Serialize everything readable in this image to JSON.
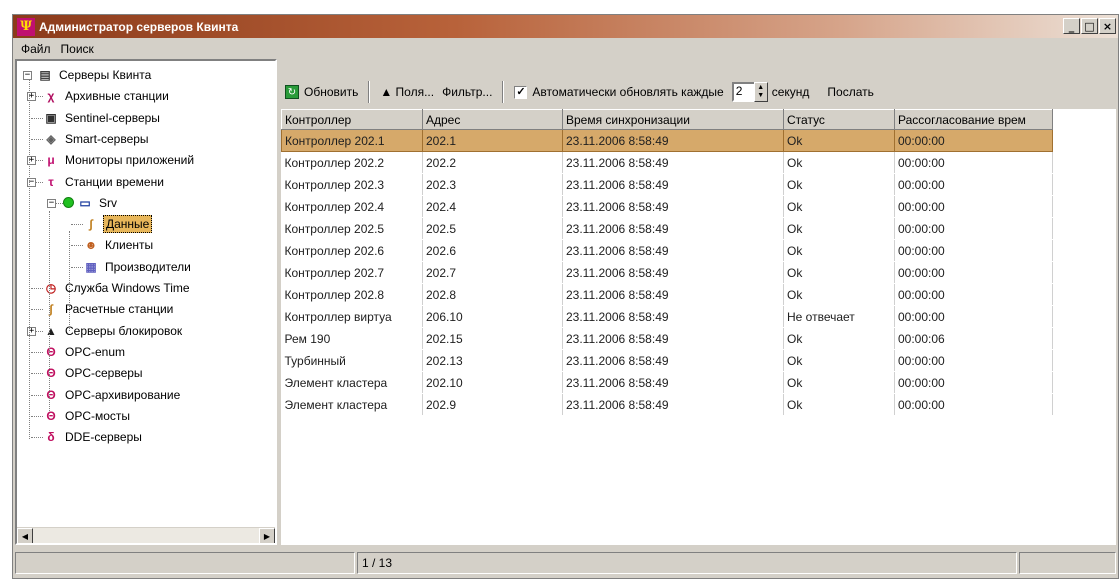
{
  "window": {
    "title": "Администратор серверов Квинта",
    "controls": [
      "_",
      "□",
      "×"
    ]
  },
  "menu": [
    "Файл",
    "Поиск"
  ],
  "tree": [
    {
      "label": "Серверы Квинта",
      "icon": "servers-icon",
      "expander": "−"
    },
    {
      "label": "Архивные станции",
      "icon": "archive-stations-icon",
      "expander": "+"
    },
    {
      "label": "Sentinel-серверы",
      "icon": "sentinel-icon",
      "expander": ""
    },
    {
      "label": "Smart-серверы",
      "icon": "smart-server-icon",
      "expander": ""
    },
    {
      "label": "Мониторы приложений",
      "icon": "mu-monitor-icon",
      "expander": "+"
    },
    {
      "label": "Станции времени",
      "icon": "tau-time-icon",
      "expander": "−"
    },
    {
      "label": "Srv",
      "icon": "computer-icon",
      "expander": "−"
    },
    {
      "label": "Данные",
      "icon": "data-icon",
      "expander": "",
      "selected": true
    },
    {
      "label": "Клиенты",
      "icon": "clients-icon",
      "expander": ""
    },
    {
      "label": "Производители",
      "icon": "producers-icon",
      "expander": ""
    },
    {
      "label": "Служба Windows Time",
      "icon": "clock-icon",
      "expander": ""
    },
    {
      "label": "Расчетные станции",
      "icon": "calc-station-icon",
      "expander": ""
    },
    {
      "label": "Серверы блокировок",
      "icon": "lock-icon",
      "expander": "+"
    },
    {
      "label": "OPC-enum",
      "icon": "theta-icon",
      "expander": ""
    },
    {
      "label": "OPC-серверы",
      "icon": "theta-icon",
      "expander": ""
    },
    {
      "label": "OPC-архивирование",
      "icon": "theta-icon",
      "expander": ""
    },
    {
      "label": "OPC-мосты",
      "icon": "theta-bridge-icon",
      "expander": ""
    },
    {
      "label": "DDE-серверы",
      "icon": "delta-icon",
      "expander": ""
    }
  ],
  "toolbar": {
    "refresh": "Обновить",
    "fields": "▲ Поля...",
    "filter": "Фильтр...",
    "auto_refresh": "Автоматически обновлять каждые",
    "auto_refresh_checked": true,
    "interval_value": "2",
    "seconds": "секунд",
    "send": "Послать"
  },
  "table": {
    "columns": [
      "Контроллер",
      "Адрес",
      "Время синхронизации",
      "Статус",
      "Рассогласование врем"
    ],
    "rows": [
      [
        "Контроллер 202.1",
        "202.1",
        "23.11.2006 8:58:49",
        "Ok",
        "00:00:00"
      ],
      [
        "Контроллер 202.2",
        "202.2",
        "23.11.2006 8:58:49",
        "Ok",
        "00:00:00"
      ],
      [
        "Контроллер 202.3",
        "202.3",
        "23.11.2006 8:58:49",
        "Ok",
        "00:00:00"
      ],
      [
        "Контроллер 202.4",
        "202.4",
        "23.11.2006 8:58:49",
        "Ok",
        "00:00:00"
      ],
      [
        "Контроллер 202.5",
        "202.5",
        "23.11.2006 8:58:49",
        "Ok",
        "00:00:00"
      ],
      [
        "Контроллер 202.6",
        "202.6",
        "23.11.2006 8:58:49",
        "Ok",
        "00:00:00"
      ],
      [
        "Контроллер 202.7",
        "202.7",
        "23.11.2006 8:58:49",
        "Ok",
        "00:00:00"
      ],
      [
        "Контроллер 202.8",
        "202.8",
        "23.11.2006 8:58:49",
        "Ok",
        "00:00:00"
      ],
      [
        "Контроллер виртуа",
        "206.10",
        "23.11.2006 8:58:49",
        "Не отвечает",
        "00:00:00"
      ],
      [
        "Рем 190",
        "202.15",
        "23.11.2006 8:58:49",
        "Ok",
        "00:00:06"
      ],
      [
        "Турбинный",
        "202.13",
        "23.11.2006 8:58:49",
        "Ok",
        "00:00:00"
      ],
      [
        "Элемент кластера",
        "202.10",
        "23.11.2006 8:58:49",
        "Ok",
        "00:00:00"
      ],
      [
        "Элемент кластера",
        "202.9",
        "23.11.2006 8:58:49",
        "Ok",
        "00:00:00"
      ]
    ],
    "selected_row": 0
  },
  "status": {
    "position": "1 / 13"
  },
  "colors": {
    "selection": "#d6a96a",
    "tree_selection": "#e7b65a",
    "title_start": "#8b3a1a"
  }
}
